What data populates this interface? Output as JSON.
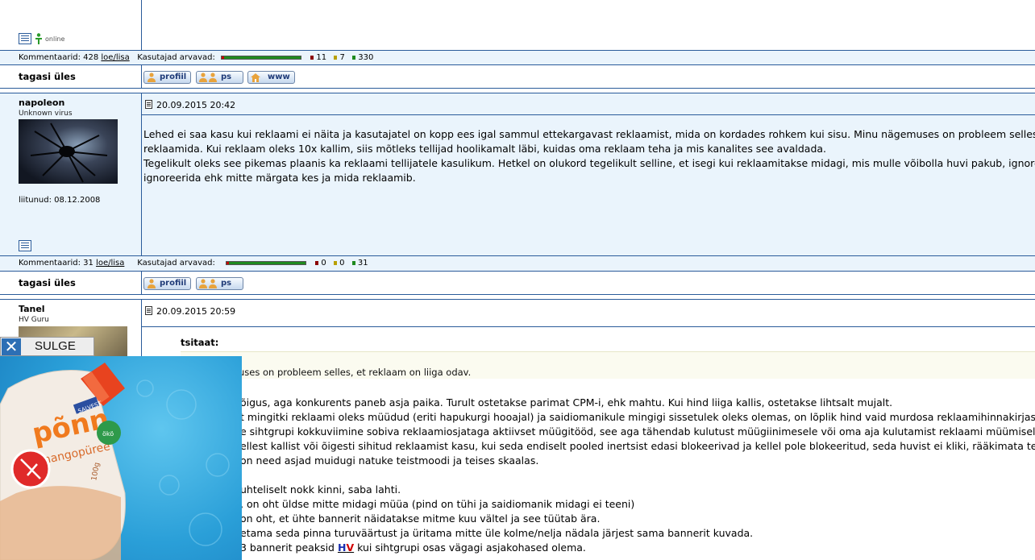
{
  "post0": {
    "online_label": "online",
    "meta": {
      "comments_label": "Kommentaarid:",
      "comments_count": "428",
      "read_add": "loe/lisa",
      "users_think": "Kasutajad arvavad:",
      "neg": "11",
      "neu": "7",
      "pos": "330"
    },
    "back_label": "tagasi üles",
    "buttons": [
      "profiil",
      "ps",
      "www"
    ]
  },
  "post1": {
    "name": "napoleon",
    "rank": "Unknown virus",
    "joined": "liitunud: 08.12.2008",
    "date": "20.09.2015 20:42",
    "lines": [
      "Lehed ei saa kasu kui reklaami ei näita ja kasutajatel on kopp ees igal sammul ettekargavast reklaamist, mida on kordades rohkem kui sisu. Minu nägemuses on probleem selles",
      "reklaamida. Kui reklaam oleks 10x kallim, siis mõtleks tellijad hoolikamalt läbi, kuidas oma reklaam teha ja mis kanalites see avaldada.",
      "Tegelikult oleks see pikemas plaanis ka reklaami tellijatele kasulikum. Hetkel on olukord tegelikult selline, et isegi kui reklaamitakse midagi, mis mulle võibolla huvi pakub, ignoree",
      "ignoreerida ehk mitte märgata kes ja mida reklaamib."
    ],
    "meta": {
      "comments_label": "Kommentaarid:",
      "comments_count": "31",
      "read_add": "loe/lisa",
      "users_think": "Kasutajad arvavad:",
      "neg": "0",
      "neu": "0",
      "pos": "31"
    },
    "back_label": "tagasi üles",
    "buttons": [
      "profiil",
      "ps"
    ]
  },
  "post2": {
    "name": "Tanel",
    "rank": "HV Guru",
    "date": "20.09.2015 20:59",
    "quote_label": "tsitaat:",
    "quote_text": "uses on probleem selles, et reklaam on liiga odav.",
    "lines": [
      "õigus, aga konkurents paneb asja paika. Turult ostetakse parimat CPM-i, ehk mahtu. Kui hind liiga kallis, ostetakse lihtsalt mujalt.",
      "t mingitki reklaami oleks müüdud (eriti hapukurgi hooajal) ja saidiomanikule mingigi sissetulek oleks olemas, on lõplik hind vaid murdosa reklaamihinnakirjast",
      "e sihtgrupi kokkuviimine sobiva reklaamiosjataga aktiivset müügitööd, see aga tähendab kulutust müügiinimesele või oma aja kulutamist reklaami müümisel",
      "ellest kallist või õigesti sihitud reklaamist kasu, kui seda endiselt pooled inertsist edasi blokeerivad ja kellel pole blokeeritud, seda huvist ei kliki, rääkimata te",
      "on need asjad muidugi natuke teistmoodi ja teises skaalas."
    ],
    "lines2": [
      "uhteliselt nokk kinni, saba lahti.",
      ", on oht üldse mitte midagi müüa (pind on tühi ja saidiomanik midagi ei teeni)",
      "on oht, et ühte bannerit näidatakse mitme kuu vältel ja see tüütab ära.",
      "etama seda pinna turuväärtust ja üritama mitte üle kolme/nelja nädala järjest sama bannerit kuvada."
    ],
    "last_pre": "3 bannerit peaksid ",
    "last_h": "H",
    "last_v": "V",
    "last_post": " kui sihtgrupi osas vägagi asjakohased olema."
  },
  "ad": {
    "close_label": "SULGE",
    "brand_top": "SALVEST",
    "brand": "põnn",
    "flavor": "mangopüree",
    "weight": "100g",
    "badge": "ökö"
  }
}
